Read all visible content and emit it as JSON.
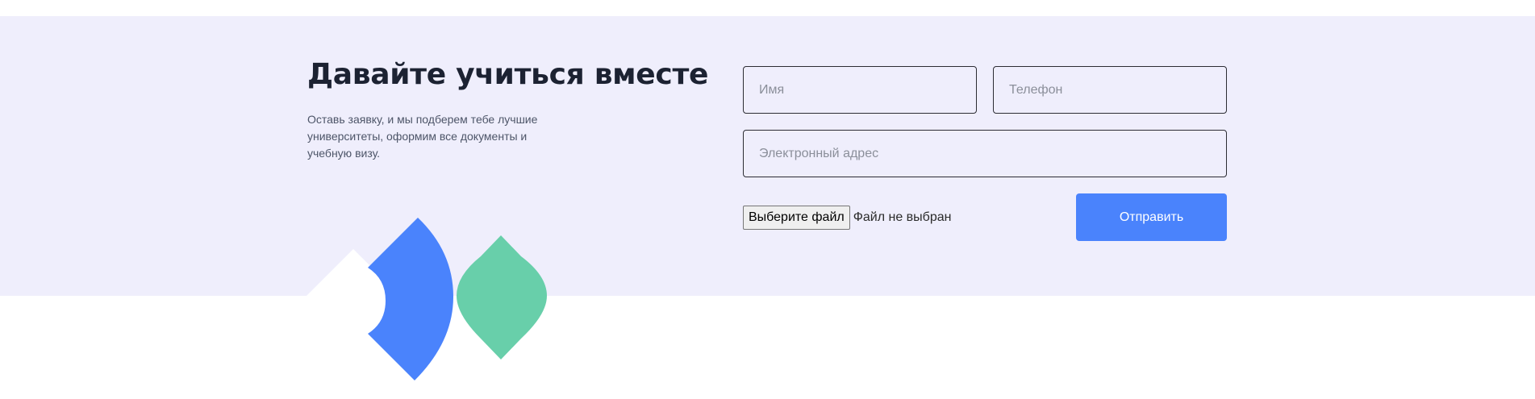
{
  "section": {
    "heading": "Давайте учиться вместе",
    "subtitle": "Оставь заявку, и мы подберем тебе лучшие университеты, оформим все документы и учебную визу."
  },
  "form": {
    "name_placeholder": "Имя",
    "phone_placeholder": "Телефон",
    "email_placeholder": "Электронный адрес",
    "file_button_label": "Выберите файл",
    "file_status": "Файл не выбран",
    "submit_label": "Отправить"
  },
  "colors": {
    "band_background": "#efeefc",
    "heading": "#1c2232",
    "accent_blue": "#4a83fc",
    "accent_green": "#68cfaa"
  },
  "decoration": {
    "icons": [
      "blue-arc-shape-icon",
      "green-leaf-shape-icon",
      "white-diamond-shape-icon"
    ]
  }
}
